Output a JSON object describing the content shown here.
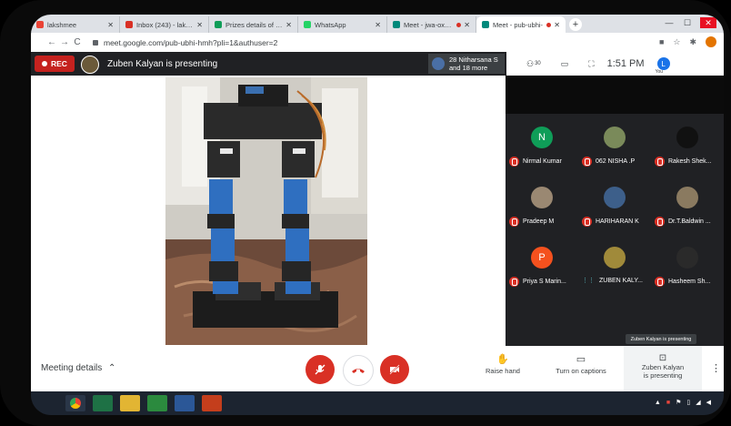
{
  "browser": {
    "tabs": [
      {
        "title": "lakshmee",
        "favicon_color": "#ea4335"
      },
      {
        "title": "Inbox (243) - lakshmi.",
        "favicon_color": "#d93025"
      },
      {
        "title": "Prizes details of events",
        "favicon_color": "#0f9d58"
      },
      {
        "title": "WhatsApp",
        "favicon_color": "#25d366"
      },
      {
        "title": "Meet - jwa-oxsh-ctj",
        "favicon_color": "#00897b"
      },
      {
        "title": "Meet - pub-ubhi-",
        "favicon_color": "#00897b"
      }
    ],
    "url": "meet.google.com/pub-ubhi-hmh?pli=1&authuser=2"
  },
  "meet": {
    "rec_label": "REC",
    "presenter_banner": "Zuben Kalyan is presenting",
    "viewers_line1": "28 Nitharsana S",
    "viewers_line2": "and 18 more",
    "participant_count": "30",
    "time": "1:51 PM",
    "self_initial": "L",
    "self_label": "You"
  },
  "participants": [
    {
      "name": "Nirmal Kumar",
      "initial": "N",
      "color": "#0f9d58",
      "status": "muted"
    },
    {
      "name": "062 NISHA .P",
      "initial": "",
      "color": "#7a8a5a",
      "status": "muted"
    },
    {
      "name": "Rakesh Shek...",
      "initial": "",
      "color": "#111111",
      "status": "muted"
    },
    {
      "name": "Pradeep M",
      "initial": "",
      "color": "#9a8872",
      "status": "muted"
    },
    {
      "name": "HARIHARAN K",
      "initial": "",
      "color": "#3d5f8a",
      "status": "muted"
    },
    {
      "name": "Dr.T.Baldwin ...",
      "initial": "",
      "color": "#8a7a60",
      "status": "muted"
    },
    {
      "name": "Priya S Marin...",
      "initial": "P",
      "color": "#f4511e",
      "status": "muted"
    },
    {
      "name": "ZUBEN KALY...",
      "initial": "",
      "color": "#a08a3a",
      "status": "speaking"
    },
    {
      "name": "Hasheem Sh...",
      "initial": "",
      "color": "#2a2a2a",
      "status": "muted"
    }
  ],
  "controls": {
    "meeting_details": "Meeting details",
    "raise_hand": "Raise hand",
    "captions": "Turn on captions",
    "present_line1": "Zuben Kalyan",
    "present_line2": "is presenting",
    "tooltip": "Zuben Kalyan is presenting"
  }
}
